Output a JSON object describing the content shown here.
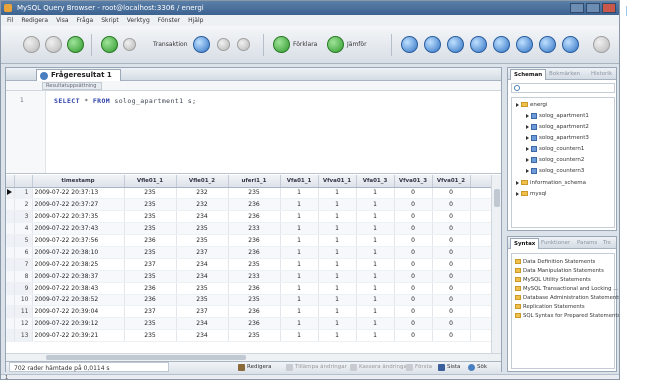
{
  "window": {
    "title": "MySQL Query Browser - root@localhost:3306 / energi",
    "controls": [
      "minimize",
      "maximize",
      "close"
    ]
  },
  "menubar": [
    "Fil",
    "Redigera",
    "Visa",
    "Fråga",
    "Skript",
    "Verktyg",
    "Fönster",
    "Hjälp"
  ],
  "toolbar": {
    "buttons": [
      {
        "name": "back-icon"
      },
      {
        "name": "forward-icon"
      },
      {
        "name": "refresh-icon"
      },
      {
        "name": "execute-icon"
      },
      {
        "name": "stop-icon"
      },
      {
        "name": "transaction-icon",
        "label": "Transaktion"
      },
      {
        "name": "commit-icon"
      },
      {
        "name": "rollback-icon"
      },
      {
        "name": "explain-icon",
        "label": "Förklara"
      },
      {
        "name": "compare-icon",
        "label": "Jämför"
      }
    ],
    "right_icons": [
      "select-icon",
      "join-icon",
      "where-icon",
      "group-icon",
      "having-icon",
      "order-icon",
      "set-icon",
      "sort-icon",
      "inspector-icon"
    ]
  },
  "editor": {
    "tab_label": "Frågeresultat 1",
    "subtab_label": "Resultatuppsättning",
    "sql_line_number": "1",
    "sql_keyword_select": "SELECT",
    "sql_mid": " * ",
    "sql_keyword_from": "FROM",
    "sql_rest": " solog_apartment1 s;"
  },
  "grid": {
    "columns": [
      "",
      "",
      "timestamp",
      "Vfle01_1",
      "Vfle01_2",
      "uferi1_1",
      "Vfa01_1",
      "Vfva01_1",
      "Vfa01_3",
      "Vfva01_3",
      "Vfva01_2",
      ""
    ],
    "rows": [
      [
        "1",
        "2009-07-22 20:37:13",
        "235",
        "232",
        "235",
        "1",
        "1",
        "1",
        "0",
        "0"
      ],
      [
        "2",
        "2009-07-22 20:37:27",
        "235",
        "232",
        "236",
        "1",
        "1",
        "1",
        "0",
        "0"
      ],
      [
        "3",
        "2009-07-22 20:37:35",
        "235",
        "234",
        "236",
        "1",
        "1",
        "1",
        "0",
        "0"
      ],
      [
        "4",
        "2009-07-22 20:37:43",
        "235",
        "235",
        "233",
        "1",
        "1",
        "1",
        "0",
        "0"
      ],
      [
        "5",
        "2009-07-22 20:37:56",
        "236",
        "235",
        "236",
        "1",
        "1",
        "1",
        "0",
        "0"
      ],
      [
        "6",
        "2009-07-22 20:38:10",
        "235",
        "237",
        "236",
        "1",
        "1",
        "1",
        "0",
        "0"
      ],
      [
        "7",
        "2009-07-22 20:38:25",
        "237",
        "234",
        "235",
        "1",
        "1",
        "1",
        "0",
        "0"
      ],
      [
        "8",
        "2009-07-22 20:38:37",
        "235",
        "234",
        "233",
        "1",
        "1",
        "1",
        "0",
        "0"
      ],
      [
        "9",
        "2009-07-22 20:38:43",
        "236",
        "235",
        "236",
        "1",
        "1",
        "1",
        "0",
        "0"
      ],
      [
        "10",
        "2009-07-22 20:38:52",
        "236",
        "235",
        "235",
        "1",
        "1",
        "1",
        "0",
        "0"
      ],
      [
        "11",
        "2009-07-22 20:39:04",
        "237",
        "237",
        "236",
        "1",
        "1",
        "1",
        "0",
        "0"
      ],
      [
        "12",
        "2009-07-22 20:39:12",
        "235",
        "234",
        "236",
        "1",
        "1",
        "1",
        "0",
        "0"
      ],
      [
        "13",
        "2009-07-22 20:39:21",
        "235",
        "234",
        "235",
        "1",
        "1",
        "1",
        "0",
        "0"
      ]
    ]
  },
  "statusbar": {
    "text": "702 rader hämtade på 0,0114 s",
    "buttons": [
      "Redigera",
      "Tillämpa ändringar",
      "Kassera ändringar",
      "Första",
      "Sista",
      "Sök"
    ],
    "search_label": "Sök"
  },
  "schema_panel": {
    "tabs": [
      "Scheman",
      "Bokmärken",
      "Historik"
    ],
    "tree": [
      {
        "label": "energi",
        "level": 0,
        "kind": "db"
      },
      {
        "label": "solog_apartment1",
        "level": 1,
        "kind": "table"
      },
      {
        "label": "solog_apartment2",
        "level": 1,
        "kind": "table"
      },
      {
        "label": "solog_apartment3",
        "level": 1,
        "kind": "table"
      },
      {
        "label": "solog_countern1",
        "level": 1,
        "kind": "table"
      },
      {
        "label": "solog_countern2",
        "level": 1,
        "kind": "table"
      },
      {
        "label": "solog_countern3",
        "level": 1,
        "kind": "table"
      },
      {
        "label": "information_schema",
        "level": 0,
        "kind": "db"
      },
      {
        "label": "mysql",
        "level": 0,
        "kind": "db"
      }
    ]
  },
  "snippets_panel": {
    "tabs": [
      "Syntax",
      "Funktioner",
      "Params",
      "Trx"
    ],
    "items": [
      "Data Definition Statements",
      "Data Manipulation Statements",
      "MySQL Utility Statements",
      "MySQL Transactional and Locking ...",
      "Database Administration Statements",
      "Replication Statements",
      "SQL Syntax for Prepared Statements"
    ]
  },
  "bottom_strip": {
    "label": "1"
  },
  "colors": {
    "window_bg": "#dbe2ea",
    "title_bar": "#3c6290",
    "sql_keyword": "#2a3fa8",
    "folder": "#f0c04a",
    "table_icon": "#6d9ad8"
  }
}
